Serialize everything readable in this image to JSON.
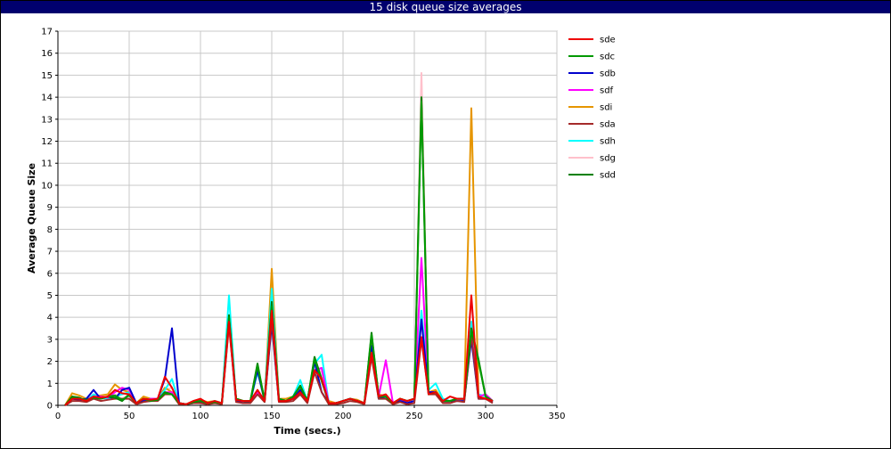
{
  "chart_data": {
    "type": "line",
    "title": "15 disk queue size averages",
    "xlabel": "Time (secs.)",
    "ylabel": "Average Queue Size",
    "xlim": [
      0,
      350
    ],
    "ylim": [
      0,
      17
    ],
    "xticks": [
      0,
      50,
      100,
      150,
      200,
      250,
      300,
      350
    ],
    "yticks": [
      0,
      1,
      2,
      3,
      4,
      5,
      6,
      7,
      8,
      9,
      10,
      11,
      12,
      13,
      14,
      15,
      16,
      17
    ],
    "grid": true,
    "legend_position": "right",
    "x": [
      5,
      10,
      15,
      20,
      25,
      30,
      35,
      40,
      45,
      50,
      55,
      60,
      65,
      70,
      75,
      80,
      85,
      90,
      95,
      100,
      105,
      110,
      115,
      120,
      125,
      130,
      135,
      140,
      145,
      150,
      155,
      160,
      165,
      170,
      175,
      180,
      185,
      190,
      195,
      200,
      205,
      210,
      215,
      220,
      225,
      230,
      235,
      240,
      245,
      250,
      255,
      260,
      265,
      270,
      275,
      280,
      285,
      290,
      295,
      300,
      305
    ],
    "series": [
      {
        "name": "sdg",
        "color": "#ffc0cb",
        "values": [
          0,
          0.4,
          0.3,
          0.25,
          0.5,
          0.3,
          0.4,
          0.5,
          0.3,
          0.5,
          0.05,
          0.3,
          0.25,
          0.2,
          0.7,
          0.8,
          0.1,
          0.05,
          0.2,
          0.2,
          0.1,
          0.15,
          0.1,
          3.9,
          0.2,
          0.15,
          0.15,
          1.5,
          0.2,
          4.7,
          0.2,
          0.2,
          0.3,
          0.8,
          0.1,
          1.8,
          1.5,
          0.1,
          0.1,
          0.2,
          0.3,
          0.2,
          0.05,
          2.6,
          0.4,
          0.3,
          0.1,
          0.2,
          0.1,
          0.2,
          15.1,
          0.6,
          0.5,
          0.1,
          0.2,
          0.3,
          0.2,
          3.4,
          0.4,
          0.3,
          0.15
        ]
      },
      {
        "name": "sdi",
        "color": "#e69500",
        "values": [
          0,
          0.55,
          0.45,
          0.3,
          0.4,
          0.45,
          0.5,
          0.95,
          0.7,
          0.6,
          0.1,
          0.4,
          0.3,
          0.3,
          0.8,
          0.6,
          0.1,
          0.05,
          0.2,
          0.25,
          0.15,
          0.2,
          0.1,
          3.6,
          0.3,
          0.2,
          0.2,
          0.7,
          0.2,
          6.2,
          0.3,
          0.3,
          0.4,
          0.6,
          0.2,
          2.0,
          1.2,
          0.2,
          0.1,
          0.2,
          0.3,
          0.25,
          0.1,
          2.9,
          0.5,
          0.4,
          0.1,
          0.3,
          0.2,
          0.3,
          4.0,
          0.6,
          0.7,
          0.2,
          0.2,
          0.3,
          0.3,
          13.5,
          0.5,
          0.4,
          0.2
        ]
      },
      {
        "name": "sdh",
        "color": "#00ffff",
        "values": [
          0,
          0.3,
          0.3,
          0.2,
          0.5,
          0.35,
          0.3,
          0.4,
          0.5,
          0.6,
          0.1,
          0.2,
          0.3,
          0.3,
          0.7,
          1.2,
          0.1,
          0.05,
          0.15,
          0.2,
          0.1,
          0.2,
          0.1,
          5.0,
          0.2,
          0.2,
          0.2,
          1.5,
          0.3,
          5.3,
          0.3,
          0.2,
          0.4,
          1.15,
          0.2,
          1.9,
          2.3,
          0.1,
          0.1,
          0.2,
          0.3,
          0.2,
          0.1,
          2.7,
          0.3,
          0.3,
          0.1,
          0.2,
          0.1,
          0.2,
          4.3,
          0.7,
          1.0,
          0.3,
          0.2,
          0.3,
          0.3,
          3.8,
          0.5,
          0.4,
          0.2
        ]
      },
      {
        "name": "sdf",
        "color": "#ff00ff",
        "values": [
          0,
          0.3,
          0.3,
          0.25,
          0.4,
          0.4,
          0.35,
          0.6,
          0.8,
          0.7,
          0.1,
          0.2,
          0.3,
          0.3,
          0.6,
          0.6,
          0.1,
          0.05,
          0.15,
          0.2,
          0.1,
          0.15,
          0.1,
          3.7,
          0.2,
          0.2,
          0.2,
          0.6,
          0.2,
          4.0,
          0.2,
          0.2,
          0.3,
          0.6,
          0.2,
          1.6,
          1.7,
          0.1,
          0.1,
          0.2,
          0.3,
          0.2,
          0.1,
          2.3,
          0.4,
          2.05,
          0.1,
          0.3,
          0.1,
          0.2,
          6.7,
          0.6,
          0.6,
          0.2,
          0.2,
          0.3,
          0.3,
          3.3,
          0.4,
          0.5,
          0.2
        ]
      },
      {
        "name": "sdb",
        "color": "#0000cd",
        "values": [
          0,
          0.3,
          0.25,
          0.3,
          0.7,
          0.3,
          0.4,
          0.3,
          0.7,
          0.8,
          0.1,
          0.2,
          0.2,
          0.3,
          1.2,
          3.5,
          0.1,
          0.05,
          0.1,
          0.15,
          0.1,
          0.15,
          0.1,
          3.9,
          0.2,
          0.1,
          0.2,
          1.6,
          0.2,
          3.7,
          0.2,
          0.2,
          0.3,
          0.7,
          0.2,
          2.0,
          0.6,
          0.1,
          0.1,
          0.2,
          0.3,
          0.2,
          0.1,
          2.7,
          0.3,
          0.4,
          0.1,
          0.2,
          0.1,
          0.2,
          3.9,
          0.6,
          0.6,
          0.2,
          0.2,
          0.2,
          0.2,
          3.0,
          0.3,
          0.3,
          0.15
        ]
      },
      {
        "name": "sda",
        "color": "#a52a2a",
        "values": [
          0,
          0.2,
          0.2,
          0.15,
          0.3,
          0.2,
          0.25,
          0.3,
          0.3,
          0.3,
          0.05,
          0.15,
          0.2,
          0.2,
          0.5,
          0.5,
          0.05,
          0.05,
          0.1,
          0.1,
          0.05,
          0.1,
          0.05,
          3.7,
          0.15,
          0.1,
          0.1,
          0.5,
          0.15,
          3.9,
          0.15,
          0.15,
          0.2,
          0.5,
          0.1,
          1.5,
          0.6,
          0.05,
          0.05,
          0.1,
          0.2,
          0.15,
          0.05,
          2.2,
          0.3,
          0.3,
          0.05,
          0.15,
          0.05,
          0.1,
          3.0,
          0.5,
          0.5,
          0.1,
          0.1,
          0.2,
          0.15,
          3.2,
          0.3,
          0.3,
          0.1
        ]
      },
      {
        "name": "sdd",
        "color": "#008000",
        "values": [
          0,
          0.4,
          0.35,
          0.2,
          0.4,
          0.3,
          0.4,
          0.35,
          0.2,
          0.5,
          0.1,
          0.3,
          0.25,
          0.25,
          0.6,
          0.5,
          0.1,
          0.05,
          0.15,
          0.2,
          0.1,
          0.15,
          0.1,
          4.1,
          0.3,
          0.2,
          0.2,
          1.9,
          0.2,
          4.7,
          0.3,
          0.2,
          0.4,
          0.9,
          0.2,
          2.2,
          1.2,
          0.1,
          0.1,
          0.2,
          0.3,
          0.2,
          0.1,
          3.3,
          0.4,
          0.4,
          0.1,
          0.3,
          0.2,
          0.3,
          14.0,
          0.5,
          0.6,
          0.2,
          0.2,
          0.3,
          0.3,
          3.5,
          2.1,
          0.4,
          0.2
        ]
      },
      {
        "name": "sdc",
        "color": "#009900",
        "values": [
          0,
          0.35,
          0.3,
          0.25,
          0.35,
          0.3,
          0.4,
          0.45,
          0.25,
          0.45,
          0.1,
          0.3,
          0.2,
          0.25,
          0.55,
          0.5,
          0.1,
          0.05,
          0.15,
          0.2,
          0.1,
          0.15,
          0.1,
          4.0,
          0.3,
          0.2,
          0.2,
          1.8,
          0.2,
          4.5,
          0.3,
          0.2,
          0.4,
          0.85,
          0.2,
          2.1,
          1.1,
          0.1,
          0.1,
          0.2,
          0.3,
          0.2,
          0.1,
          3.2,
          0.4,
          0.4,
          0.1,
          0.3,
          0.2,
          0.3,
          13.8,
          0.5,
          0.6,
          0.2,
          0.2,
          0.3,
          0.3,
          3.4,
          2.0,
          0.4,
          0.2
        ]
      },
      {
        "name": "sde",
        "color": "#ee0000",
        "values": [
          0,
          0.3,
          0.3,
          0.2,
          0.4,
          0.35,
          0.4,
          0.7,
          0.55,
          0.5,
          0.1,
          0.3,
          0.25,
          0.3,
          1.3,
          0.8,
          0.1,
          0.05,
          0.2,
          0.3,
          0.1,
          0.2,
          0.1,
          3.8,
          0.25,
          0.2,
          0.2,
          0.7,
          0.2,
          4.3,
          0.2,
          0.2,
          0.3,
          0.6,
          0.2,
          1.6,
          1.2,
          0.1,
          0.1,
          0.2,
          0.3,
          0.2,
          0.1,
          2.4,
          0.4,
          0.5,
          0.1,
          0.3,
          0.2,
          0.3,
          3.1,
          0.5,
          0.6,
          0.2,
          0.4,
          0.3,
          0.3,
          5.0,
          0.4,
          0.3,
          0.2
        ]
      }
    ],
    "legend": [
      {
        "name": "sde",
        "color": "#ee0000"
      },
      {
        "name": "sdc",
        "color": "#009900"
      },
      {
        "name": "sdb",
        "color": "#0000cd"
      },
      {
        "name": "sdf",
        "color": "#ff00ff"
      },
      {
        "name": "sdi",
        "color": "#e69500"
      },
      {
        "name": "sda",
        "color": "#a52a2a"
      },
      {
        "name": "sdh",
        "color": "#00ffff"
      },
      {
        "name": "sdg",
        "color": "#ffc0cb"
      },
      {
        "name": "sdd",
        "color": "#008000"
      }
    ]
  }
}
